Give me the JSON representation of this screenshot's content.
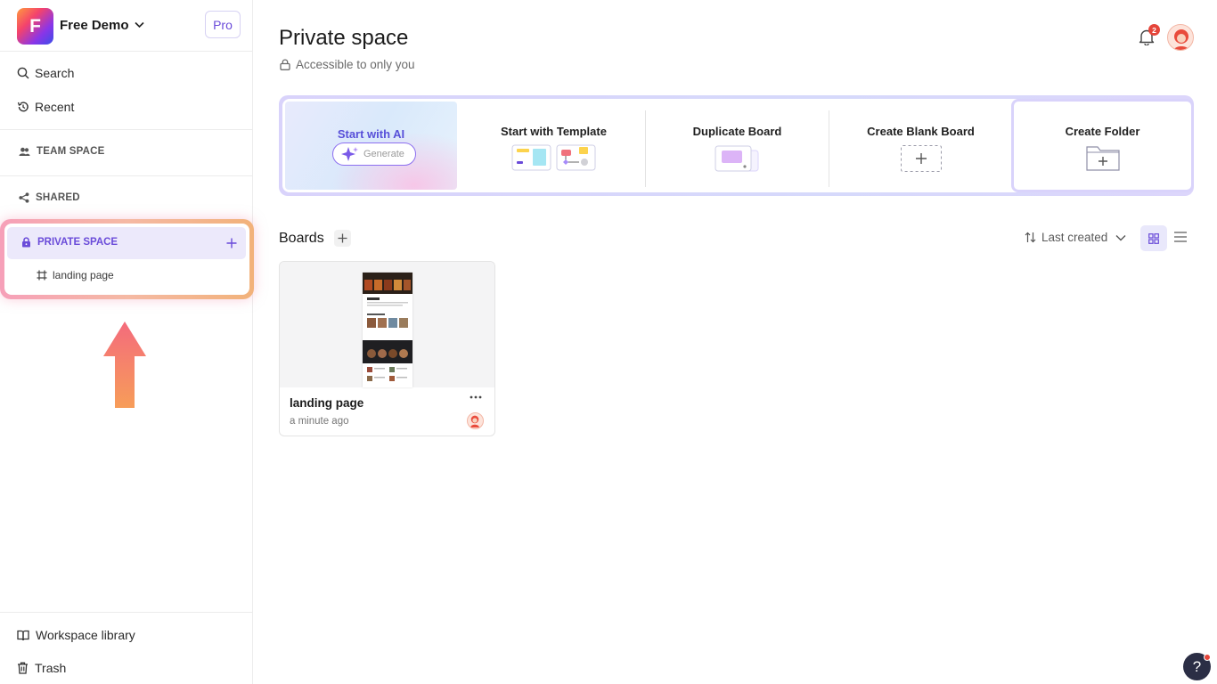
{
  "workspace": {
    "logo_letter": "F",
    "name": "Free Demo",
    "plan_badge": "Pro"
  },
  "sidebar": {
    "search_label": "Search",
    "recent_label": "Recent",
    "team_space_label": "TEAM SPACE",
    "shared_label": "SHARED",
    "private_space_label": "PRIVATE SPACE",
    "private_boards": [
      {
        "label": "landing page"
      }
    ],
    "workspace_library_label": "Workspace library",
    "trash_label": "Trash"
  },
  "header": {
    "title": "Private space",
    "subtitle": "Accessible to only you",
    "notification_count": "2"
  },
  "actions": {
    "ai_title": "Start with AI",
    "ai_generate_placeholder": "Generate",
    "template_title": "Start with Template",
    "duplicate_title": "Duplicate Board",
    "blank_title": "Create Blank Board",
    "folder_title": "Create Folder"
  },
  "boards": {
    "section_label": "Boards",
    "sort_label": "Last created",
    "items": [
      {
        "title": "landing page",
        "time": "a minute ago"
      }
    ]
  },
  "help_label": "?",
  "colors": {
    "accent": "#6a4bd9",
    "highlight_border": "#f5b9a4",
    "badge": "#e5453a"
  }
}
